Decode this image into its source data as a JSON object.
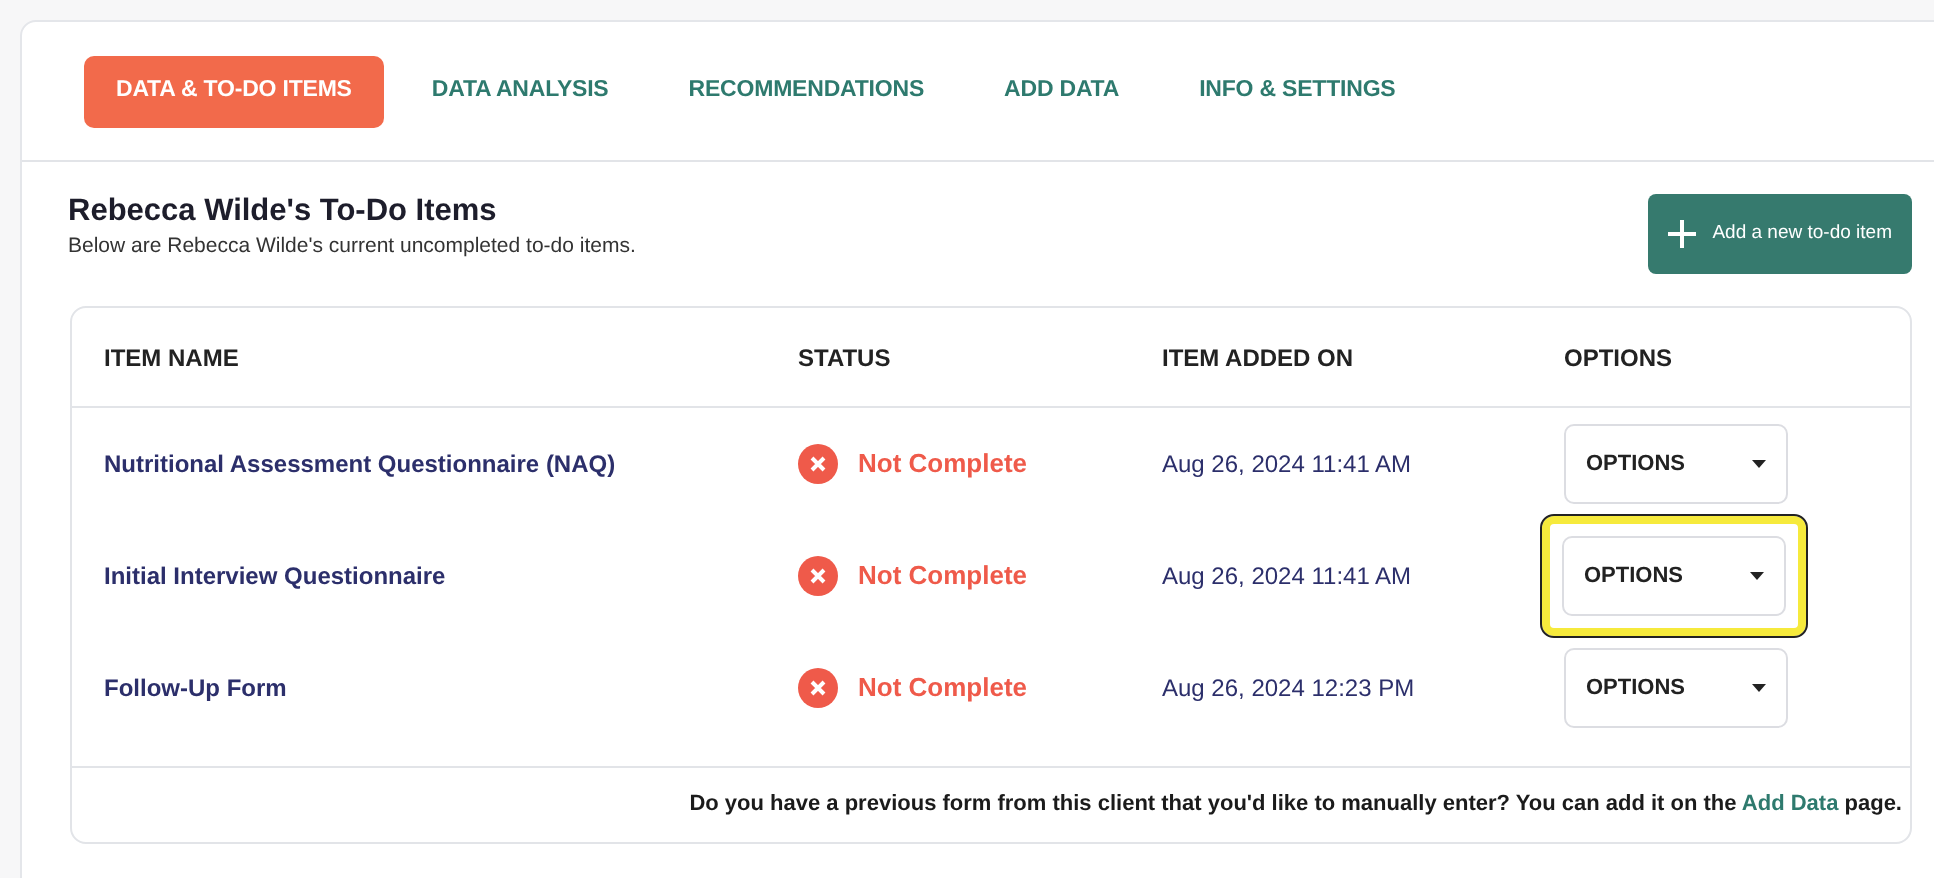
{
  "tabs": [
    {
      "label": "DATA & TO-DO ITEMS",
      "selected": true
    },
    {
      "label": "DATA ANALYSIS",
      "selected": false
    },
    {
      "label": "RECOMMENDATIONS",
      "selected": false
    },
    {
      "label": "ADD DATA",
      "selected": false
    },
    {
      "label": "INFO & SETTINGS",
      "selected": false
    }
  ],
  "header": {
    "title": "Rebecca Wilde's To-Do Items",
    "subtitle": "Below are Rebecca Wilde's current uncompleted to-do items.",
    "add_button": "Add a new to-do item"
  },
  "table": {
    "columns": [
      "ITEM NAME",
      "STATUS",
      "ITEM ADDED ON",
      "OPTIONS"
    ],
    "rows": [
      {
        "name": "Nutritional Assessment Questionnaire (NAQ)",
        "status": "Not Complete",
        "complete": false,
        "added": "Aug 26, 2024 11:41 AM",
        "options": "OPTIONS",
        "highlighted": false
      },
      {
        "name": "Initial Interview Questionnaire",
        "status": "Not Complete",
        "complete": false,
        "added": "Aug 26, 2024 11:41 AM",
        "options": "OPTIONS",
        "highlighted": true
      },
      {
        "name": "Follow-Up Form",
        "status": "Not Complete",
        "complete": false,
        "added": "Aug 26, 2024 12:23 PM",
        "options": "OPTIONS",
        "highlighted": false
      }
    ]
  },
  "footer": {
    "text_before": "Do you have a previous form from this client that you'd like to manually enter? You can add it on the ",
    "link": "Add Data",
    "text_after": " page."
  }
}
